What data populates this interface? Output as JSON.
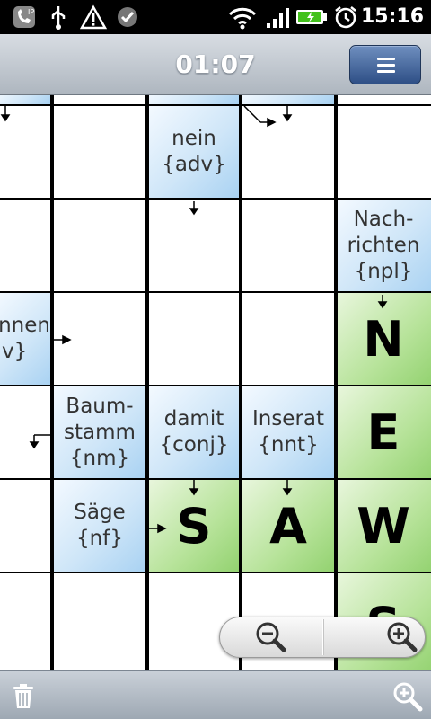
{
  "status_bar": {
    "time": "15:16",
    "icons": [
      "call-ip-icon",
      "usb-icon",
      "warning-icon",
      "check-icon",
      "wifi-icon",
      "signal-icon",
      "battery-icon",
      "alarm-icon"
    ]
  },
  "header": {
    "timer": "01:07",
    "menu_icon": "menu-icon"
  },
  "grid": {
    "clues": {
      "nein": {
        "word": "nein",
        "type": "{adv}"
      },
      "nachrichten": {
        "line1": "Nach-",
        "line2": "richten",
        "type": "{npl}"
      },
      "partial_left": {
        "line1": "nnen",
        "line2": "v}"
      },
      "baumstamm": {
        "line1": "Baum-",
        "line2": "stamm",
        "type": "{nm}"
      },
      "damit": {
        "word": "damit",
        "type": "{conj}"
      },
      "inserat": {
        "word": "Inserat",
        "type": "{nnt}"
      },
      "saege": {
        "word": "Säge",
        "type": "{nf}"
      }
    },
    "answers": {
      "n": "N",
      "e": "E",
      "s": "S",
      "a": "A",
      "w": "W",
      "s_partial": "S"
    }
  },
  "bottom_bar": {
    "left_icon": "trash-icon",
    "right_icon": "zoom-icon"
  },
  "zoom_control": {
    "out_icon": "zoom-out-icon",
    "in_icon": "zoom-in-icon"
  }
}
